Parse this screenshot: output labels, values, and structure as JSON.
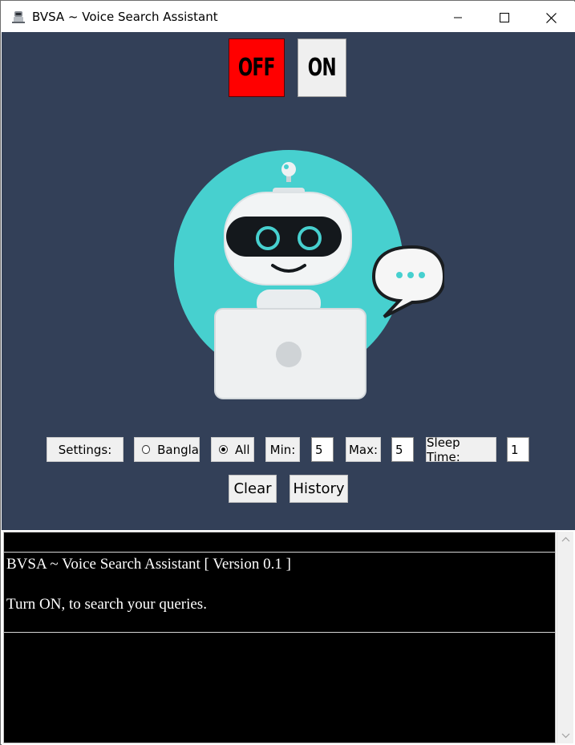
{
  "window": {
    "title": "BVSA ~ Voice Search Assistant",
    "app_icon": "robot-icon",
    "controls": [
      "minimize-icon",
      "maximize-icon",
      "close-icon"
    ]
  },
  "power": {
    "off_label": "OFF",
    "on_label": "ON",
    "colors": {
      "off": "#ff0000",
      "on": "#efefef"
    }
  },
  "illustration": {
    "name": "robot-with-laptop",
    "bubble": "speech-bubble-icon"
  },
  "settings": {
    "label": "Settings:",
    "language_options": [
      {
        "label": "Bangla",
        "selected": false
      },
      {
        "label": "All",
        "selected": true
      }
    ],
    "min_label": "Min:",
    "min_value": "5",
    "max_label": "Max:",
    "max_value": "5",
    "sleep_label": "Sleep Time:",
    "sleep_value": "1"
  },
  "actions": {
    "clear_label": "Clear",
    "history_label": "History"
  },
  "console": {
    "line1": "BVSA ~ Voice Search Assistant [ Version 0.1 ]",
    "line2": "Turn ON, to search your queries."
  },
  "colors": {
    "background": "#334058",
    "console_bg": "#000000",
    "accent": "#4ad0cf"
  }
}
